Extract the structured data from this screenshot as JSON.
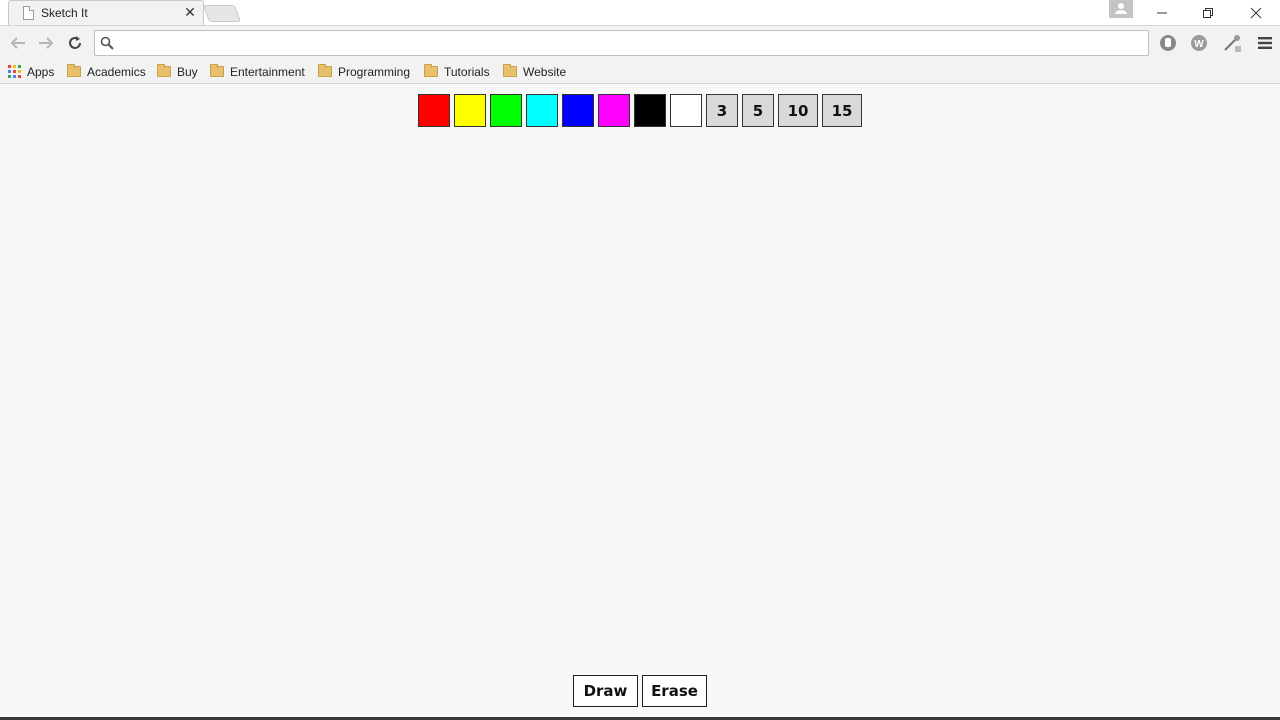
{
  "tab": {
    "title": "Sketch It",
    "close": "✕"
  },
  "omnibox": {
    "value": "",
    "placeholder": ""
  },
  "bookmarks": [
    {
      "label": "Apps",
      "icon": "apps-grid-icon"
    },
    {
      "label": "Academics",
      "icon": "folder-icon"
    },
    {
      "label": "Buy",
      "icon": "folder-icon"
    },
    {
      "label": "Entertainment",
      "icon": "folder-icon"
    },
    {
      "label": "Programming",
      "icon": "folder-icon"
    },
    {
      "label": "Tutorials",
      "icon": "folder-icon"
    },
    {
      "label": "Website",
      "icon": "folder-icon"
    }
  ],
  "palette": {
    "colors": [
      "#ff0000",
      "#ffff00",
      "#00ff00",
      "#00ffff",
      "#0000ff",
      "#ff00ff",
      "#000000",
      "#ffffff"
    ],
    "sizes": [
      "3",
      "5",
      "10",
      "15"
    ]
  },
  "modes": {
    "draw": "Draw",
    "erase": "Erase"
  }
}
